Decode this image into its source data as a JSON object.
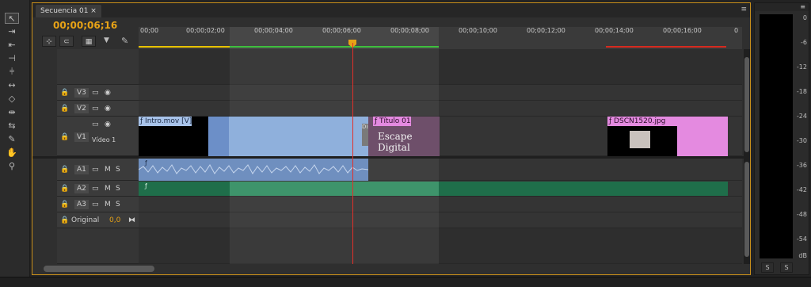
{
  "tab": {
    "label": "Secuencia 01",
    "close": "×"
  },
  "panel_menu": "≡",
  "timecode": "00;00;06;16",
  "ruler": {
    "ticks": [
      "00;00",
      "00;00;02;00",
      "00;00;04;00",
      "00;00;06;00",
      "00;00;08;00",
      "00;00;10;00",
      "00;00;12;00",
      "00;00;14;00",
      "00;00;16;00",
      "0"
    ]
  },
  "tracks": {
    "v3": "V3",
    "v2": "V2",
    "v1": "V1",
    "v1_name": "Vídeo 1",
    "a1": "A1",
    "a2": "A2",
    "a3": "A3",
    "original": "Original",
    "original_value": "0,0"
  },
  "track_buttons": {
    "m": "M",
    "s": "S"
  },
  "clips": {
    "intro": "Intro.mov [V]",
    "titulo": "Título 01",
    "titulo_text": "Escape Digital",
    "dsc": "DSCN1520.jpg",
    "dis": "Dis"
  },
  "meter": {
    "db_labels": [
      "0",
      "-6",
      "-12",
      "-18",
      "-24",
      "-30",
      "-36",
      "-42",
      "-48",
      "-54",
      "dB"
    ],
    "solo_left": "S",
    "solo_right": "S"
  },
  "colors": {
    "accent": "#e8a316",
    "video_clip": "#8fb0dc",
    "title_clip": "#e48ae0",
    "audio_clip": "#1f6e4a",
    "playhead": "#e2302a"
  },
  "icons": {
    "selection_tool": "selection-arrow-icon",
    "track_select_forward": "track-select-forward-icon",
    "track_select_backward": "track-select-backward-icon",
    "ripple_edit": "ripple-edit-icon",
    "rolling_edit": "rolling-edit-icon",
    "rate_stretch": "rate-stretch-icon",
    "razor": "razor-icon",
    "slip": "slip-icon",
    "slide": "slide-icon",
    "pen": "pen-icon",
    "hand": "hand-icon",
    "zoom": "zoom-icon"
  }
}
